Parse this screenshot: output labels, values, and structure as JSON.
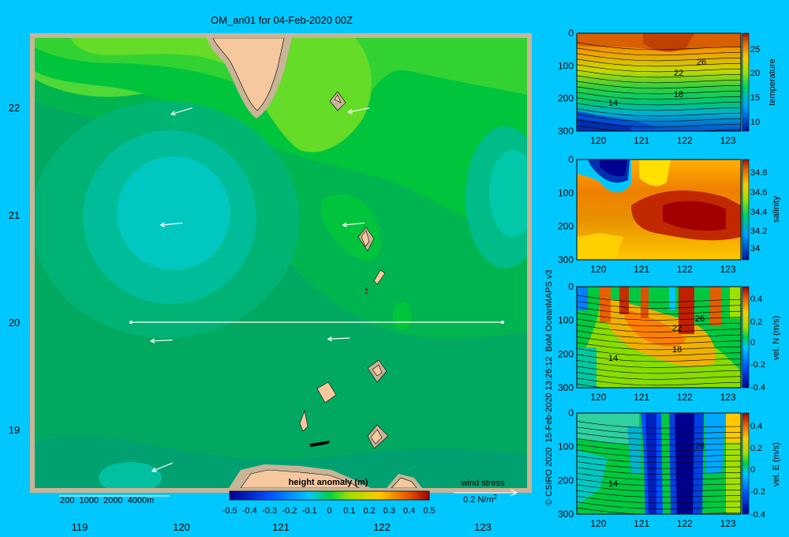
{
  "title": "OM_an01 for 04-Feb-2020 00Z",
  "credit": "© CSIRO 2020  15-Feb-2020 13:26:12  BoM OceanMAPS v3",
  "colors": {
    "background": "#00c8ff",
    "frame": "#c8b496",
    "land": "#f5c8a0",
    "shelf": "#c8b496"
  },
  "map": {
    "lon_ticks": [
      "119",
      "120",
      "121",
      "122",
      "123"
    ],
    "lat_ticks": [
      "22",
      "21",
      "20",
      "19"
    ],
    "xlim": [
      118.5,
      123.5
    ],
    "ylim": [
      18.2,
      22.7
    ],
    "depth_legend": "200  1000  2000  4000m",
    "colorbar_title": "height anomaly (m)",
    "colorbar_ticks": [
      "-0.5",
      "-0.4",
      "-0.3",
      "-0.2",
      "-0.1",
      "0",
      "0.1",
      "0.2",
      "0.3",
      "0.4",
      "0.5"
    ],
    "wind_label": "wind stress",
    "wind_scale": "0.2 N/m",
    "wind_scale_sup": "2",
    "section_line": {
      "lat": 20.0,
      "lon_start": 119.5,
      "lon_end": 123.2
    }
  },
  "chart_data": [
    {
      "type": "heatmap",
      "title": "OM_an01 for 04-Feb-2020 00Z",
      "colorbar_label": "height anomaly (m)",
      "xlim": [
        118.5,
        123.5
      ],
      "ylim": [
        18.2,
        22.7
      ],
      "crange": [
        -0.5,
        0.5
      ],
      "wind_vectors": [
        {
          "lon": 120.1,
          "lat": 22.0,
          "u": -1,
          "v": -0.3
        },
        {
          "lon": 121.9,
          "lat": 22.0,
          "u": -1,
          "v": -0.2
        },
        {
          "lon": 120.0,
          "lat": 20.85,
          "u": -1,
          "v": -0.1
        },
        {
          "lon": 121.85,
          "lat": 20.85,
          "u": -1,
          "v": -0.1
        },
        {
          "lon": 119.9,
          "lat": 19.68,
          "u": -1,
          "v": -0.05
        },
        {
          "lon": 121.7,
          "lat": 19.7,
          "u": -1,
          "v": -0.05
        },
        {
          "lon": 119.9,
          "lat": 18.45,
          "u": -1,
          "v": -0.4
        }
      ]
    },
    {
      "type": "heatmap",
      "ylabel": "temperature",
      "xlim": [
        119.5,
        123.3
      ],
      "ylim": [
        300,
        0
      ],
      "colorbar_ticks": [
        "25",
        "20",
        "15",
        "10"
      ],
      "contour_labels": [
        "26",
        "22",
        "18",
        "14"
      ]
    },
    {
      "type": "heatmap",
      "ylabel": "salinity",
      "xlim": [
        119.5,
        123.3
      ],
      "ylim": [
        300,
        0
      ],
      "colorbar_ticks": [
        "34.8",
        "34.6",
        "34.4",
        "34.2",
        "34"
      ]
    },
    {
      "type": "heatmap",
      "ylabel": "vel. N (m/s)",
      "xlim": [
        119.5,
        123.3
      ],
      "ylim": [
        300,
        0
      ],
      "colorbar_ticks": [
        "0.4",
        "0.2",
        "0",
        "-0.2",
        "-0.4"
      ],
      "contour_labels": [
        "26",
        "22",
        "18",
        "14"
      ]
    },
    {
      "type": "heatmap",
      "ylabel": "vel. E (m/s)",
      "xlim": [
        119.5,
        123.3
      ],
      "ylim": [
        300,
        0
      ],
      "colorbar_ticks": [
        "0.4",
        "0.2",
        "0",
        "-0.2",
        "-0.4"
      ],
      "contour_labels": [
        "26",
        "14"
      ]
    }
  ],
  "sections": {
    "x_ticks": [
      "120",
      "121",
      "122",
      "123"
    ],
    "y_ticks": [
      "0",
      "100",
      "200",
      "300"
    ]
  }
}
